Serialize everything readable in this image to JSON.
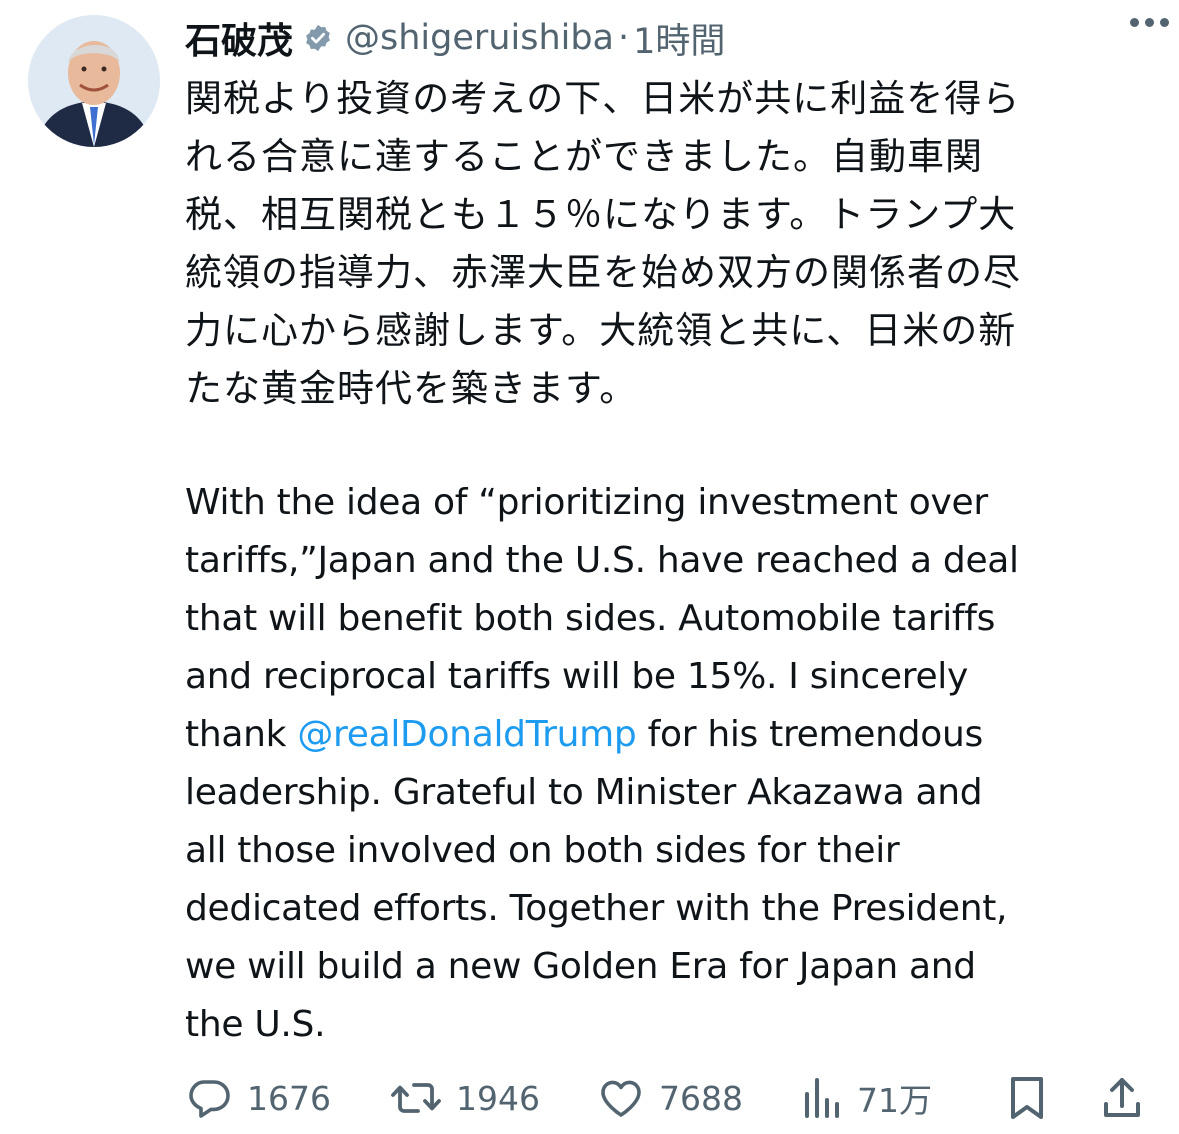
{
  "tweet": {
    "author_name": "石破茂",
    "handle": "@shigeruishiba",
    "separator": "·",
    "time": "1時間",
    "text_jp_lines": [
      "関税より投資の考えの下、日米が共に利益を得ら",
      "れる合意に達することができました。自動車関",
      "税、相互関税とも１５％になります。トランプ大",
      "統領の指導力、赤澤大臣を始め双方の関係者の尽",
      "力に心から感謝します。大統領と共に、日米の新",
      "たな黄金時代を築きます。"
    ],
    "text_en_lines": [
      "With the idea of “prioritizing investment over",
      "tariffs,”Japan and the U.S. have reached a deal",
      "that will benefit both sides. Automobile tariffs",
      "and reciprocal tariffs will be 15%. I sincerely"
    ],
    "mention_prefix": "thank ",
    "mention": "@realDonaldTrump",
    "mention_suffix": " for his tremendous",
    "text_en_lines_after": [
      "leadership. Grateful to Minister Akazawa and",
      "all those involved on both sides for their",
      "dedicated efforts. Together with the President,",
      "we will build a new Golden Era for Japan and",
      "the U.S."
    ]
  },
  "actions": {
    "replies": "1676",
    "reposts": "1946",
    "likes": "7688",
    "views": "71万"
  },
  "colors": {
    "text": "#0f1419",
    "secondary": "#536471",
    "link": "#1d9bf0",
    "verified_badge": "#829aab"
  },
  "icons": {
    "verified": "verified-badge-icon",
    "more": "more-dots-icon",
    "reply": "reply-icon",
    "repost": "repost-icon",
    "like": "heart-icon",
    "views": "views-chart-icon",
    "bookmark": "bookmark-icon",
    "share": "share-icon"
  }
}
